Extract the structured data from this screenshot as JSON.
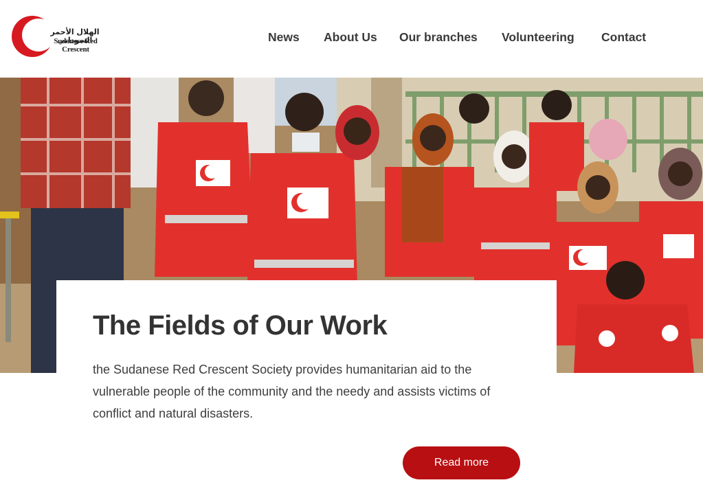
{
  "header": {
    "logo": {
      "arabic_name": "الهلال الأحمر السوداني",
      "english_name": "Sudanese Red Crescent",
      "brand_color": "#d71920"
    },
    "nav": [
      {
        "label": "News"
      },
      {
        "label": "About Us"
      },
      {
        "label": "Our branches"
      },
      {
        "label": "Volunteering"
      },
      {
        "label": "Contact"
      }
    ]
  },
  "card": {
    "title": "The Fields of Our Work",
    "description": "the Sudanese Red Crescent Society provides humanitarian aid to the vulnerable people of the community and the needy and assists victims of conflict and natural disasters.",
    "button_label": "Read more",
    "button_color": "#b80f12"
  }
}
